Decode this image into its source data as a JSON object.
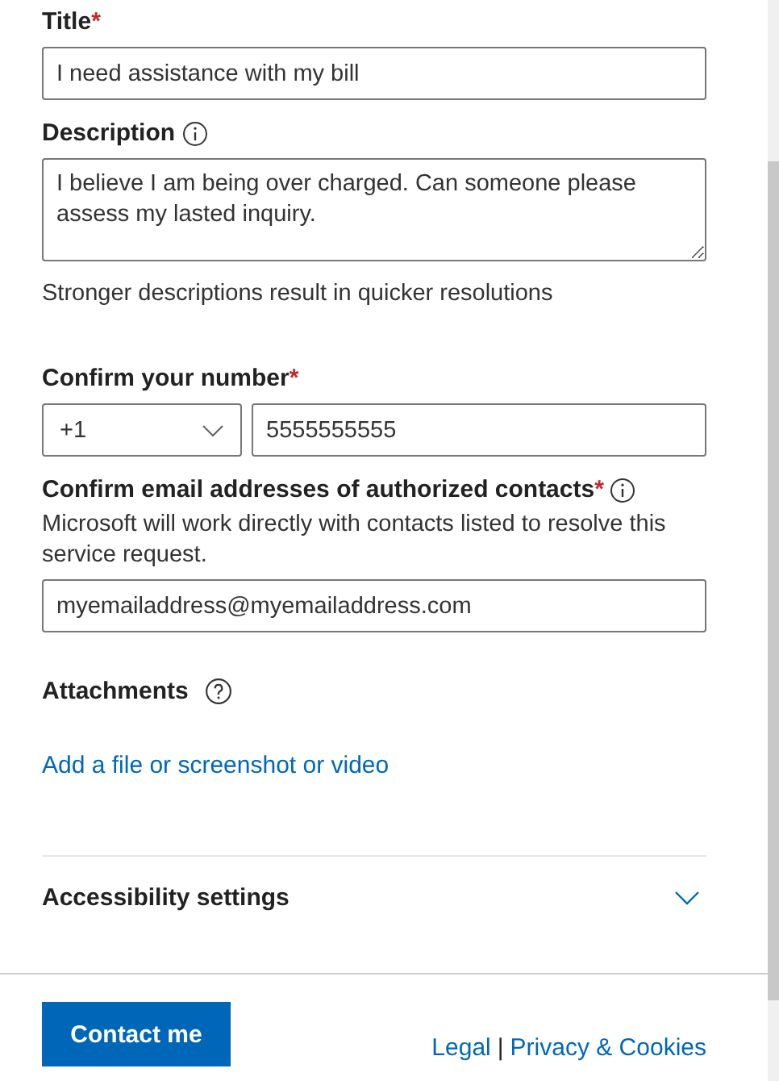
{
  "form": {
    "fields": [
      {
        "kind": "text",
        "label": "Title",
        "required_mark": "*",
        "value": "I need assistance with my bill"
      },
      {
        "kind": "textarea",
        "label": "Description",
        "hint": {
          "kind": "info"
        },
        "value": "I believe I am being over charged. Can someone please assess my lasted inquiry.",
        "helper": "Stronger descriptions result in quicker resolutions"
      },
      {
        "kind": "phone",
        "label": "Confirm your number",
        "required_mark": "*",
        "country_code": "+1",
        "value": "5555555555"
      },
      {
        "kind": "email",
        "label": "Confirm email addresses of authorized contacts",
        "required_mark": "*",
        "hint": {
          "kind": "info"
        },
        "description": "Microsoft will work directly with contacts listed to resolve this service request.",
        "value": "myemailaddress@myemailaddress.com"
      }
    ],
    "attachments": {
      "label": "Attachments",
      "hint": {
        "kind": "question"
      },
      "link": "Add a file or screenshot or video"
    },
    "accessibility": {
      "label": "Accessibility settings",
      "expanded": false
    }
  },
  "footer": {
    "button": "Contact me",
    "links": [
      "Legal",
      "Privacy & Cookies"
    ],
    "separator": "|"
  }
}
